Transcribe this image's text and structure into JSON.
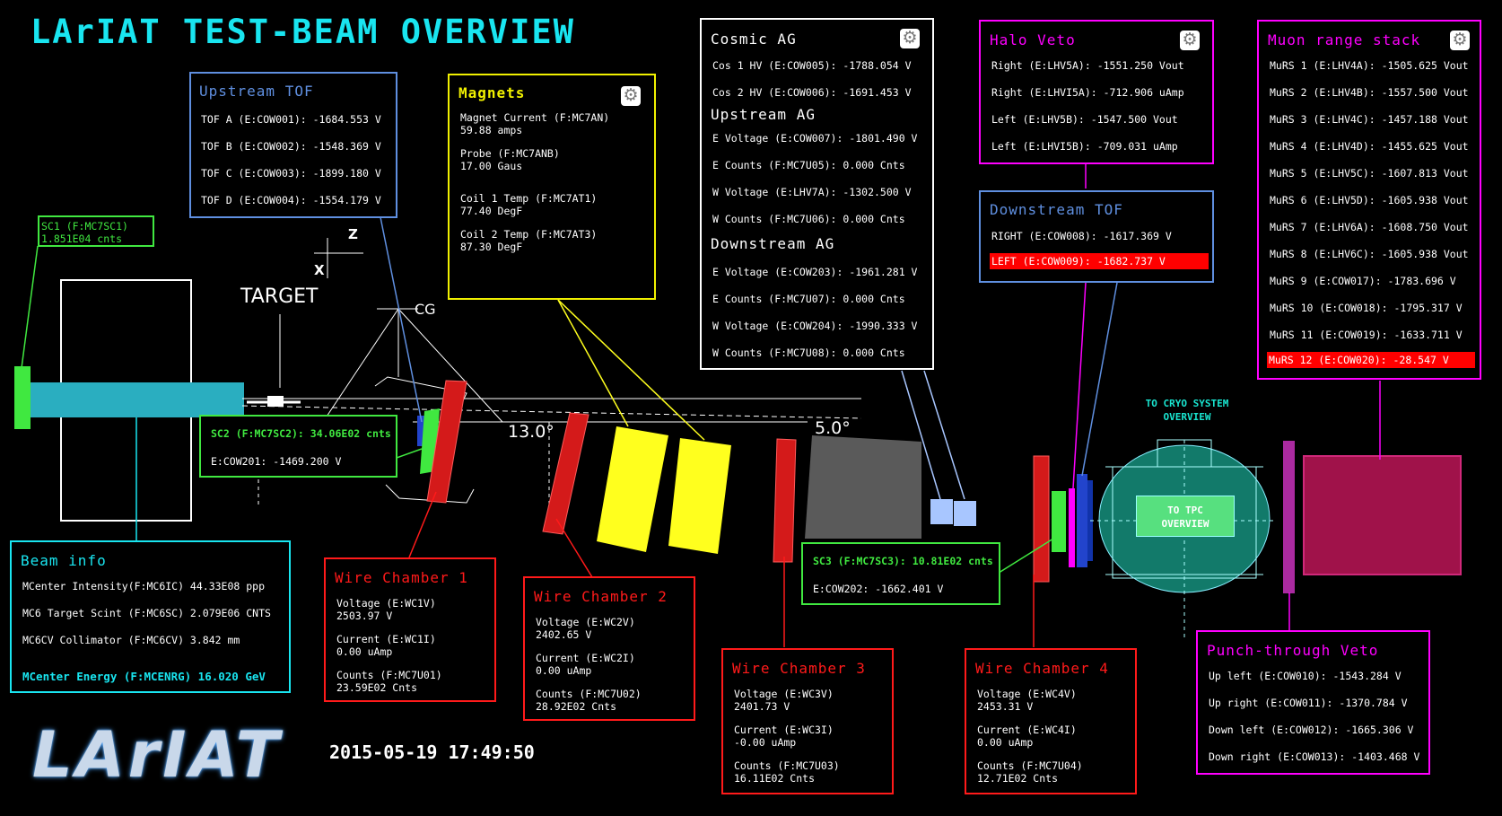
{
  "title": "LArIAT TEST-BEAM OVERVIEW",
  "timestamp": "2015-05-19 17:49:50",
  "logo_text": "LArIAT",
  "colors": {
    "title": "#19e5f0",
    "upstream_tof": "#5f8fe0",
    "magnets": "#f0f000",
    "cosmic": "#ffffff",
    "halo": "#ff00ff",
    "downstream_tof": "#5f8fe0",
    "muon": "#ff00ff",
    "sc": "#40e840",
    "beam_info": "#19e5f0",
    "wire": "#ff1a1a",
    "alarm": "#ff0000"
  },
  "sc1": {
    "line1": "SC1 (F:MC7SC1)",
    "line2": "1.851E04 cnts"
  },
  "upstream_tof": {
    "title": "Upstream TOF",
    "rows": [
      "TOF A (E:COW001): -1684.553 V",
      "TOF B (E:COW002): -1548.369 V",
      "TOF C (E:COW003): -1899.180 V",
      "TOF D (E:COW004): -1554.179 V"
    ]
  },
  "magnets": {
    "title": "Magnets",
    "items": [
      {
        "label": "Magnet Current (F:MC7AN)",
        "value": "59.88 amps"
      },
      {
        "label": "Probe (F:MC7ANB)",
        "value": "17.00 Gaus"
      },
      {
        "label": "Coil 1 Temp (F:MC7AT1)",
        "value": "77.40 DegF"
      },
      {
        "label": "Coil 2 Temp (F:MC7AT3)",
        "value": "87.30 DegF"
      }
    ]
  },
  "cosmic_ag": {
    "title": "Cosmic AG",
    "rows": [
      "Cos 1 HV (E:COW005): -1788.054 V",
      "Cos 2 HV (E:COW006): -1691.453 V"
    ],
    "upstream_title": "Upstream AG",
    "upstream_rows": [
      "E Voltage (E:COW007): -1801.490 V",
      "E Counts (F:MC7U05): 0.000 Cnts",
      "W Voltage (E:LHV7A): -1302.500 V",
      "W Counts (F:MC7U06): 0.000 Cnts"
    ],
    "downstream_title": "Downstream AG",
    "downstream_rows": [
      "E Voltage (E:COW203): -1961.281 V",
      "E Counts (F:MC7U07): 0.000 Cnts",
      "W Voltage (E:COW204): -1990.333 V",
      "W Counts (F:MC7U08): 0.000 Cnts"
    ]
  },
  "halo_veto": {
    "title": "Halo Veto",
    "rows": [
      "Right (E:LHV5A): -1551.250 Vout",
      "Right (E:LHVI5A): -712.906 uAmp",
      "Left (E:LHV5B): -1547.500 Vout",
      "Left (E:LHVI5B): -709.031 uAmp"
    ]
  },
  "downstream_tof": {
    "title": "Downstream TOF",
    "rows": [
      "RIGHT (E:COW008): -1617.369 V",
      "LEFT (E:COW009): -1682.737 V"
    ]
  },
  "muon_range": {
    "title": "Muon range stack",
    "rows": [
      "MuRS 1 (E:LHV4A): -1505.625 Vout",
      "MuRS 2 (E:LHV4B): -1557.500 Vout",
      "MuRS 3 (E:LHV4C): -1457.188 Vout",
      "MuRS 4 (E:LHV4D): -1455.625 Vout",
      "MuRS 5 (E:LHV5C): -1607.813 Vout",
      "MuRS 6 (E:LHV5D): -1605.938 Vout",
      "MuRS 7 (E:LHV6A): -1608.750 Vout",
      "MuRS 8 (E:LHV6C): -1605.938 Vout",
      "MuRS 9 (E:COW017): -1783.696 V",
      "MuRS 10 (E:COW018): -1795.317 V",
      "MuRS 11 (E:COW019): -1633.711 V",
      "MuRS 12 (E:COW020): -28.547 V"
    ]
  },
  "sc2": {
    "line1": "SC2 (F:MC7SC2): 34.06E02 cnts",
    "line2": "E:COW201: -1469.200 V"
  },
  "sc3": {
    "line1": "SC3 (F:MC7SC3): 10.81E02 cnts",
    "line2": "E:COW202: -1662.401 V"
  },
  "beam_info": {
    "title": "Beam info",
    "rows": [
      "MCenter Intensity(F:MC6IC) 44.33E08 ppp",
      "MC6 Target Scint (F:MC6SC) 2.079E06 CNTS",
      "MC6CV Collimator (F:MC6CV) 3.842 mm"
    ],
    "energy": "MCenter Energy (F:MCENRG) 16.020 GeV"
  },
  "wire_chambers": [
    {
      "title": "Wire Chamber 1",
      "items": [
        {
          "label": "Voltage (E:WC1V)",
          "value": "2503.97 V"
        },
        {
          "label": "Current (E:WC1I)",
          "value": "0.00 uAmp"
        },
        {
          "label": "Counts (F:MC7U01)",
          "value": "23.59E02 Cnts"
        }
      ]
    },
    {
      "title": "Wire Chamber 2",
      "items": [
        {
          "label": "Voltage (E:WC2V)",
          "value": "2402.65 V"
        },
        {
          "label": "Current (E:WC2I)",
          "value": "0.00 uAmp"
        },
        {
          "label": "Counts (F:MC7U02)",
          "value": "28.92E02 Cnts"
        }
      ]
    },
    {
      "title": "Wire Chamber 3",
      "items": [
        {
          "label": "Voltage (E:WC3V)",
          "value": "2401.73 V"
        },
        {
          "label": "Current (E:WC3I)",
          "value": "-0.00 uAmp"
        },
        {
          "label": "Counts (F:MC7U03)",
          "value": "16.11E02 Cnts"
        }
      ]
    },
    {
      "title": "Wire Chamber 4",
      "items": [
        {
          "label": "Voltage (E:WC4V)",
          "value": "2453.31 V"
        },
        {
          "label": "Current (E:WC4I)",
          "value": "0.00 uAmp"
        },
        {
          "label": "Counts (F:MC7U04)",
          "value": "12.71E02 Cnts"
        }
      ]
    }
  ],
  "punch_through": {
    "title": "Punch-through Veto",
    "rows": [
      "Up left (E:COW010): -1543.284 V",
      "Up right (E:COW011): -1370.784 V",
      "Down left (E:COW012): -1665.306 V",
      "Down right (E:COW013): -1403.468 V"
    ]
  },
  "beamline": {
    "target_label": "TARGET",
    "cg_label": "CG",
    "z_label": "Z",
    "x_label": "X",
    "angle1": "13.0°",
    "angle2": "5.0°"
  },
  "cryo_link": {
    "line1": "TO CRYO SYSTEM",
    "line2": "OVERVIEW"
  },
  "tpc_link": {
    "line1": "TO TPC",
    "line2": "OVERVIEW"
  }
}
